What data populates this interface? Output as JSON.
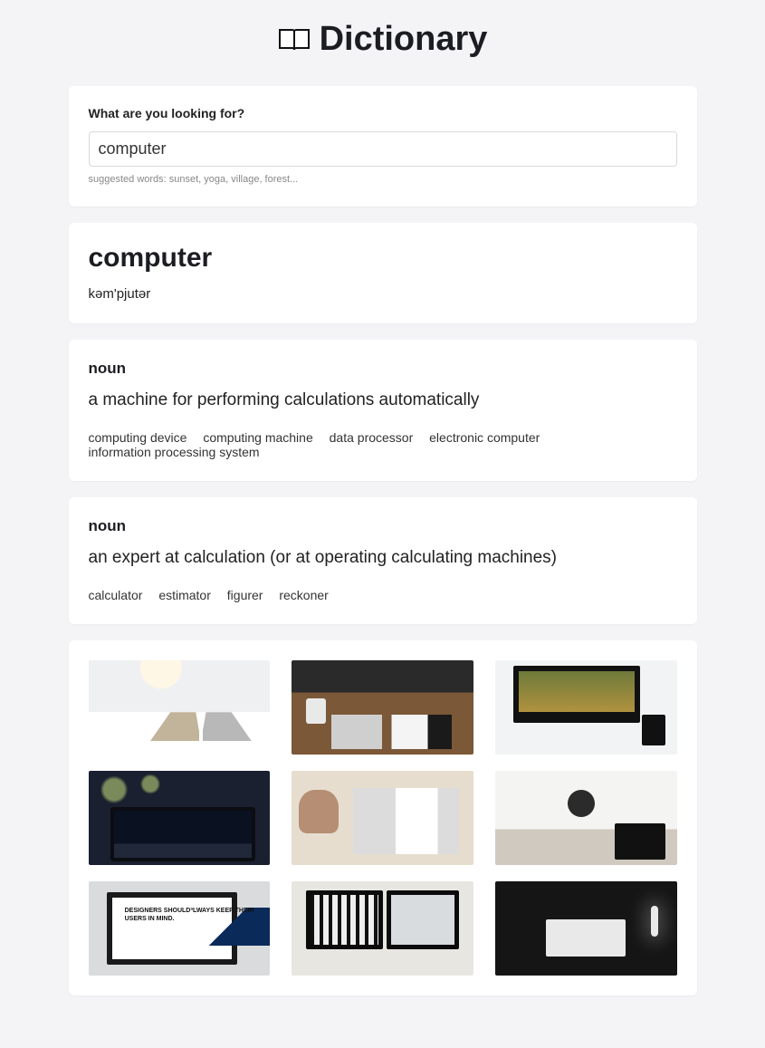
{
  "title": "Dictionary",
  "search": {
    "label": "What are you looking for?",
    "value": "computer",
    "suggest": "suggested words: sunset, yoga, village, forest..."
  },
  "result": {
    "word": "computer",
    "phonetic": "kəm'pjutər"
  },
  "meanings": [
    {
      "partOfSpeech": "noun",
      "definition": "a machine for performing calculations automatically",
      "synonyms": [
        "computing device",
        "computing machine",
        "data processor",
        "electronic computer",
        "information processing system"
      ]
    },
    {
      "partOfSpeech": "noun",
      "definition": "an expert at calculation (or at operating calculating machines)",
      "synonyms": [
        "calculator",
        "estimator",
        "figurer",
        "reckoner"
      ]
    }
  ],
  "gallery": [
    {
      "name": "laptops-on-white-desk"
    },
    {
      "name": "laptop-coffee-notebook-on-wood-desk"
    },
    {
      "name": "imac-forest-wallpaper"
    },
    {
      "name": "laptop-dark-mountain-wallpaper"
    },
    {
      "name": "person-at-desk-top-down"
    },
    {
      "name": "bright-room-laptop"
    },
    {
      "name": "monitor-design-slide"
    },
    {
      "name": "dual-monitors-design-app"
    },
    {
      "name": "dark-room-imac-lamp"
    }
  ]
}
